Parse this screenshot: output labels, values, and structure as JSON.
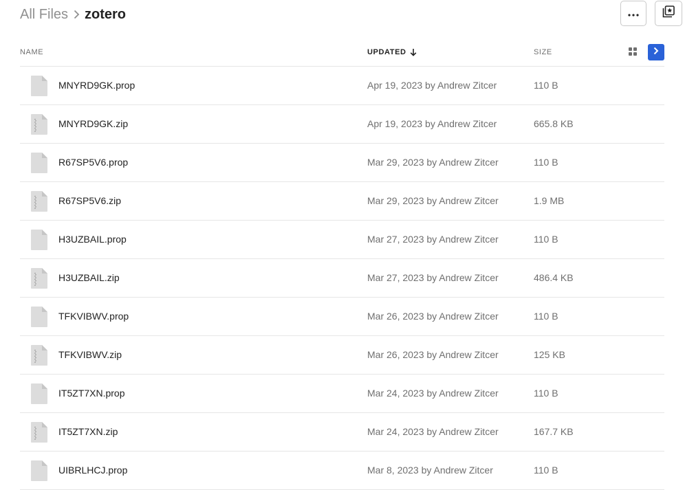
{
  "breadcrumb": {
    "root": "All Files",
    "current": "zotero"
  },
  "toolbar": {
    "more_icon": "more-horizontal-icon",
    "collections_icon": "collections-star-icon"
  },
  "table": {
    "columns": {
      "name": "NAME",
      "updated": "UPDATED",
      "size": "SIZE"
    },
    "sort": {
      "column": "updated",
      "direction": "descending"
    },
    "view_toggle_icon": "grid-view-icon",
    "sidebar_toggle_icon": "chevron-right-icon",
    "accent_color": "#2a62d8",
    "rows": [
      {
        "name": "MNYRD9GK.prop",
        "updated": "Apr 19, 2023 by Andrew Zitcer",
        "size": "110 B",
        "icon": "file-icon"
      },
      {
        "name": "MNYRD9GK.zip",
        "updated": "Apr 19, 2023 by Andrew Zitcer",
        "size": "665.8 KB",
        "icon": "zip-file-icon"
      },
      {
        "name": "R67SP5V6.prop",
        "updated": "Mar 29, 2023 by Andrew Zitcer",
        "size": "110 B",
        "icon": "file-icon"
      },
      {
        "name": "R67SP5V6.zip",
        "updated": "Mar 29, 2023 by Andrew Zitcer",
        "size": "1.9 MB",
        "icon": "zip-file-icon"
      },
      {
        "name": "H3UZBAIL.prop",
        "updated": "Mar 27, 2023 by Andrew Zitcer",
        "size": "110 B",
        "icon": "file-icon"
      },
      {
        "name": "H3UZBAIL.zip",
        "updated": "Mar 27, 2023 by Andrew Zitcer",
        "size": "486.4 KB",
        "icon": "zip-file-icon"
      },
      {
        "name": "TFKVIBWV.prop",
        "updated": "Mar 26, 2023 by Andrew Zitcer",
        "size": "110 B",
        "icon": "file-icon"
      },
      {
        "name": "TFKVIBWV.zip",
        "updated": "Mar 26, 2023 by Andrew Zitcer",
        "size": "125 KB",
        "icon": "zip-file-icon"
      },
      {
        "name": "IT5ZT7XN.prop",
        "updated": "Mar 24, 2023 by Andrew Zitcer",
        "size": "110 B",
        "icon": "file-icon"
      },
      {
        "name": "IT5ZT7XN.zip",
        "updated": "Mar 24, 2023 by Andrew Zitcer",
        "size": "167.7 KB",
        "icon": "zip-file-icon"
      },
      {
        "name": "UIBRLHCJ.prop",
        "updated": "Mar 8, 2023 by Andrew Zitcer",
        "size": "110 B",
        "icon": "file-icon"
      }
    ]
  }
}
